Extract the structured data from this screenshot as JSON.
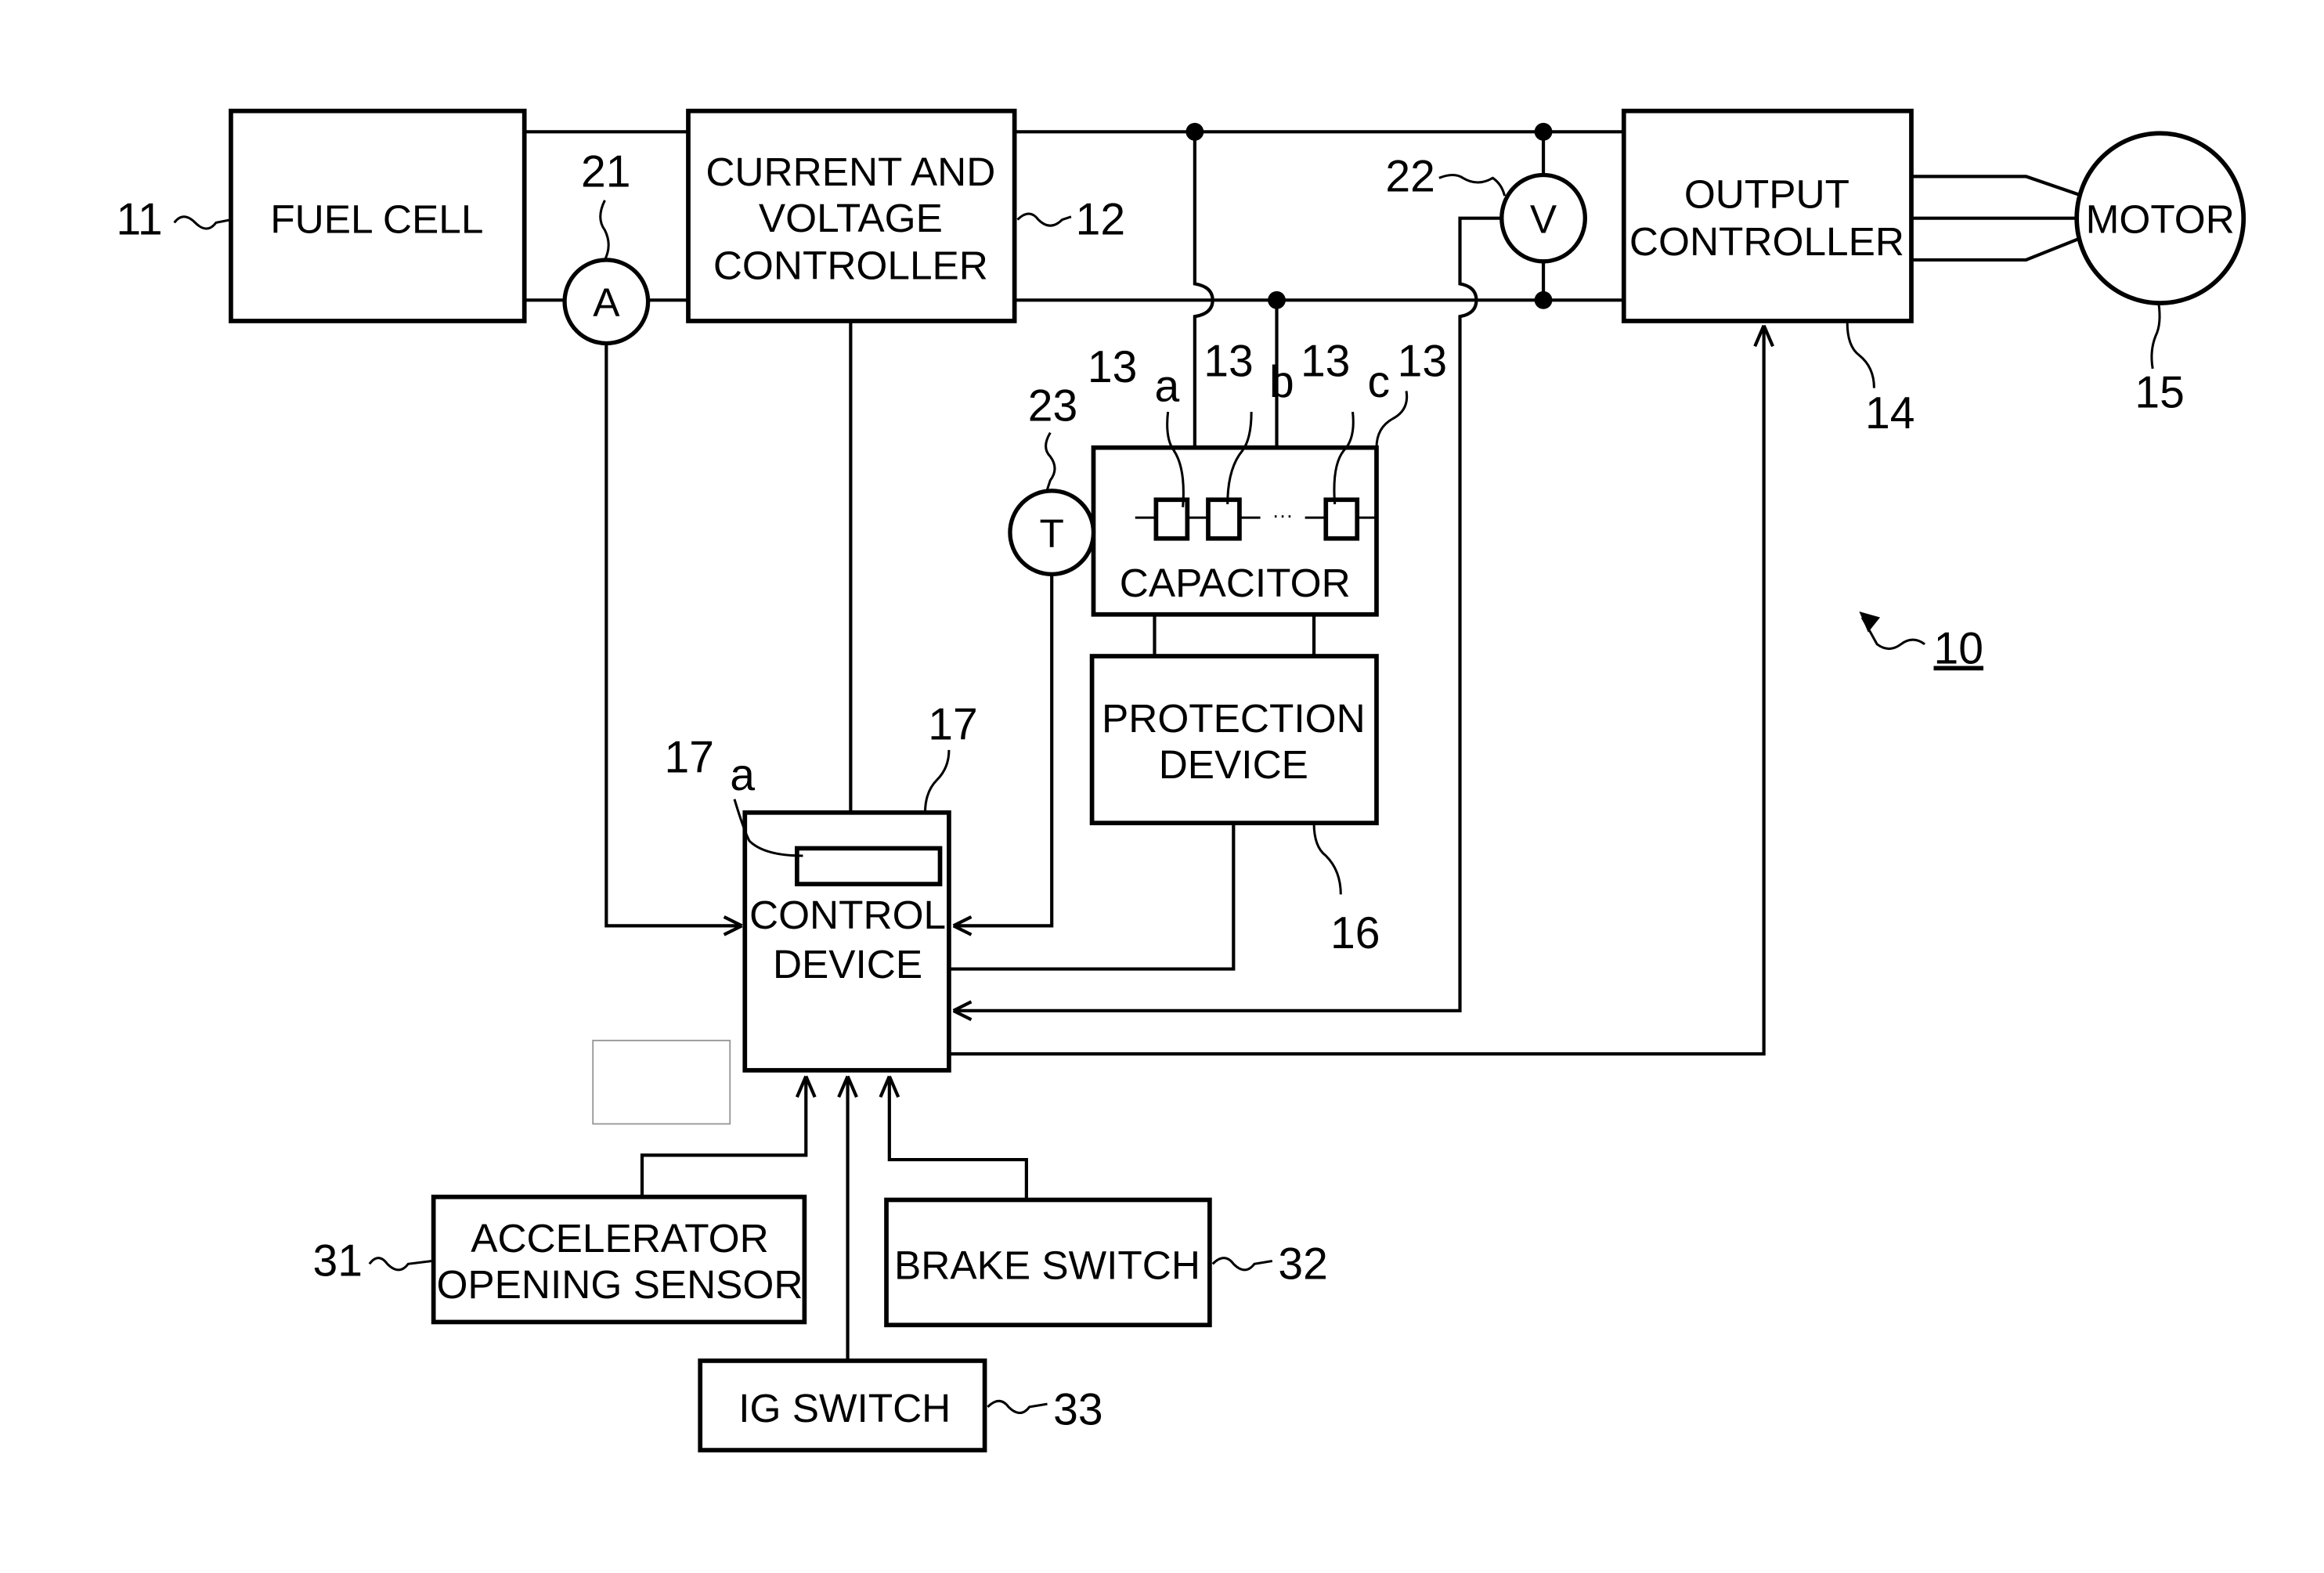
{
  "figure": {
    "system_ref": "10",
    "blocks": {
      "fuel_cell": {
        "ref": "11",
        "lines": [
          "FUEL CELL"
        ]
      },
      "cv_controller": {
        "ref": "12",
        "lines": [
          "CURRENT AND",
          "VOLTAGE",
          "CONTROLLER"
        ]
      },
      "capacitor": {
        "ref": "13",
        "lines": [
          "CAPACITOR"
        ],
        "cell_refs": [
          "13a",
          "13b",
          "13c"
        ],
        "cell_ref_parts": {
          "num": "13",
          "a": "a",
          "b": "b",
          "c": "c"
        },
        "ellipsis": "···"
      },
      "output_controller": {
        "ref": "14",
        "lines": [
          "OUTPUT",
          "CONTROLLER"
        ]
      },
      "motor": {
        "ref": "15",
        "lines": [
          "MOTOR"
        ]
      },
      "protection_device": {
        "ref": "16",
        "lines": [
          "PROTECTION",
          "DEVICE"
        ]
      },
      "control_device": {
        "ref": "17",
        "lines": [
          "CONTROL",
          "DEVICE"
        ],
        "sub_ref_num": "17",
        "sub_ref_letter": "a"
      },
      "accelerator_sensor": {
        "ref": "31",
        "lines": [
          "ACCELERATOR",
          "OPENING SENSOR"
        ]
      },
      "brake_switch": {
        "ref": "32",
        "lines": [
          "BRAKE SWITCH"
        ]
      },
      "ig_switch": {
        "ref": "33",
        "lines": [
          "IG SWITCH"
        ]
      }
    },
    "sensors": {
      "ammeter": {
        "ref": "21",
        "symbol": "A"
      },
      "voltmeter": {
        "ref": "22",
        "symbol": "V"
      },
      "thermometer": {
        "ref": "23",
        "symbol": "T"
      }
    }
  }
}
